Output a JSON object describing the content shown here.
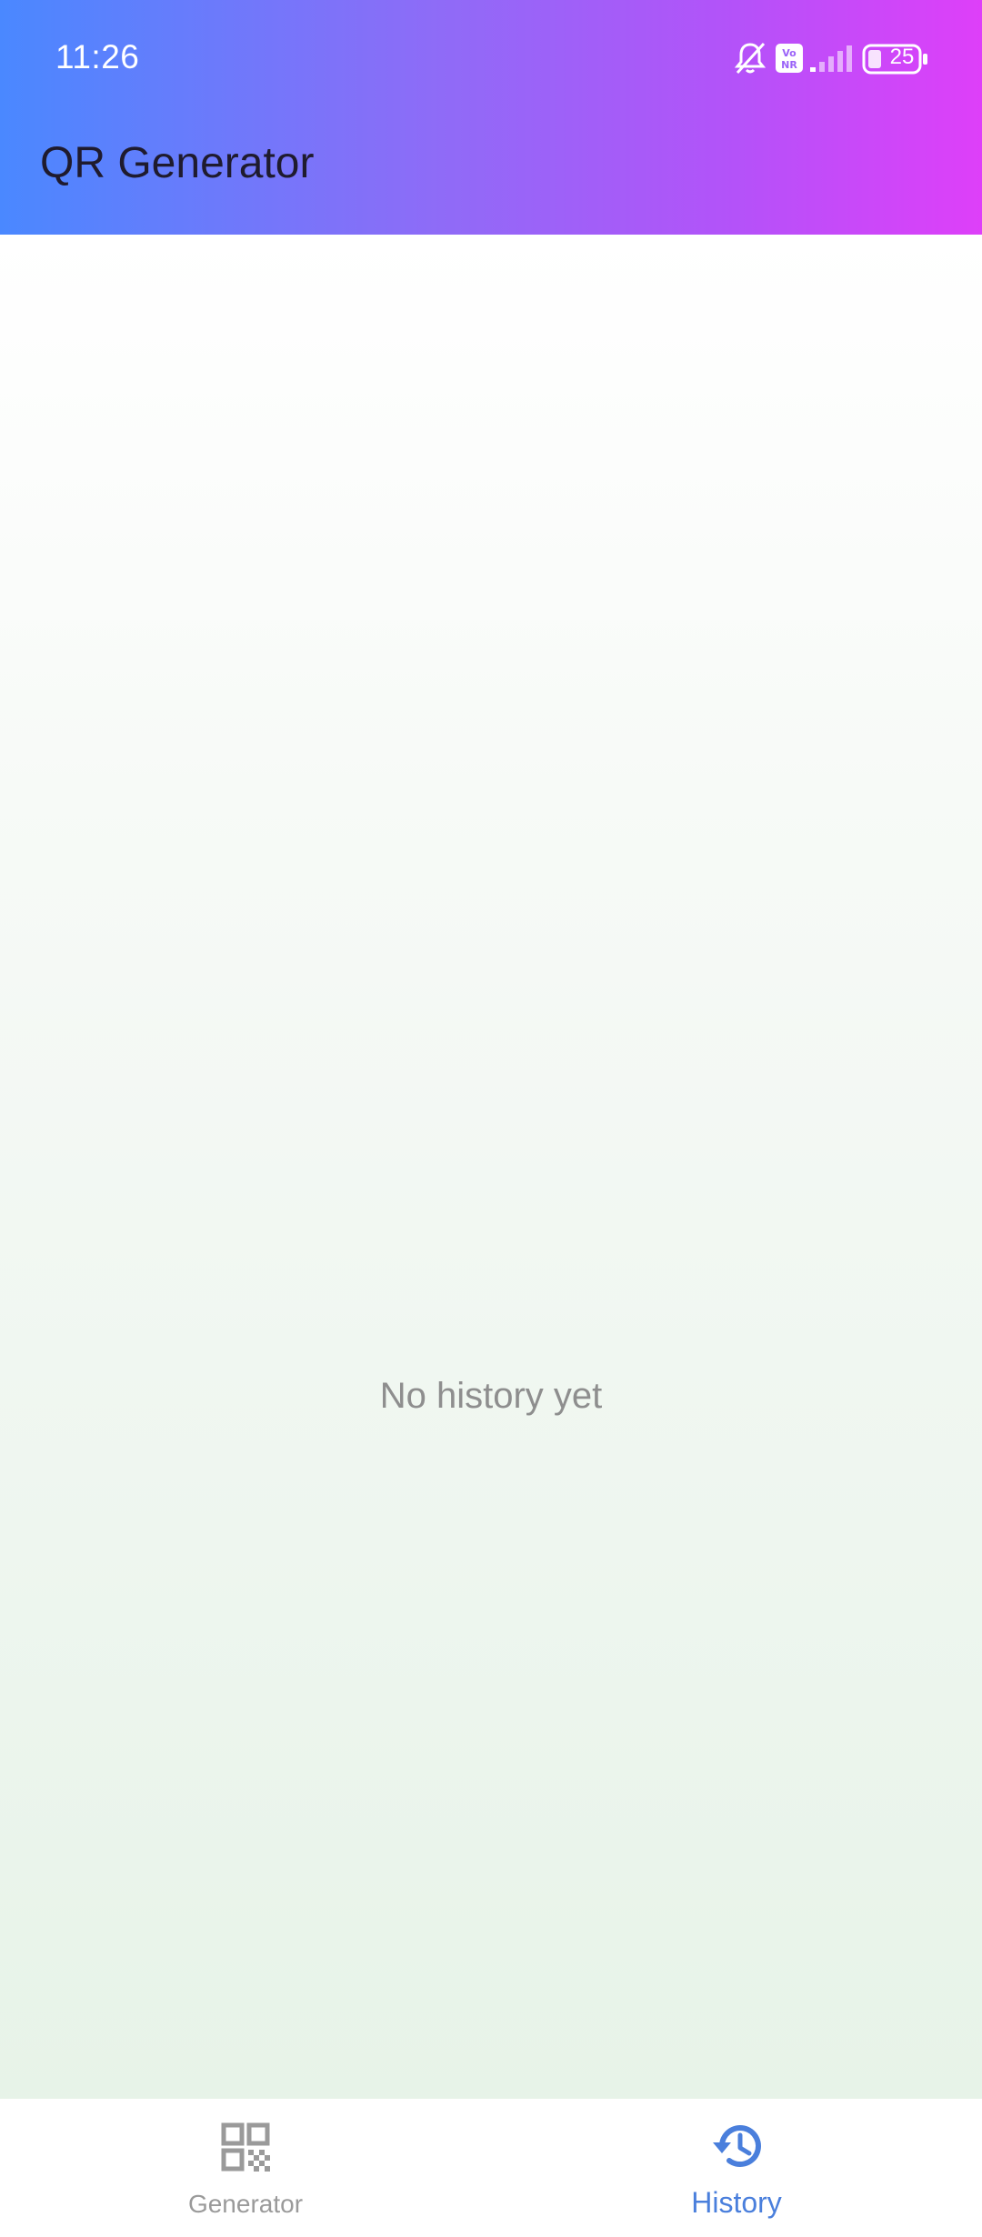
{
  "status_bar": {
    "time": "11:26",
    "battery": "25",
    "icons": [
      "bell-off-icon",
      "vonr-icon",
      "signal-icon",
      "battery-icon"
    ]
  },
  "app_bar": {
    "title": "QR Generator",
    "gradient": [
      "#4a88ff",
      "#de3ff9"
    ]
  },
  "content": {
    "empty_message": "No history yet"
  },
  "bottom_nav": {
    "items": [
      {
        "label": "Generator",
        "icon": "qr-code-icon",
        "active": false
      },
      {
        "label": "History",
        "icon": "history-icon",
        "active": true
      }
    ],
    "active_color": "#4a7fdc",
    "inactive_color": "#9a9a9a"
  }
}
